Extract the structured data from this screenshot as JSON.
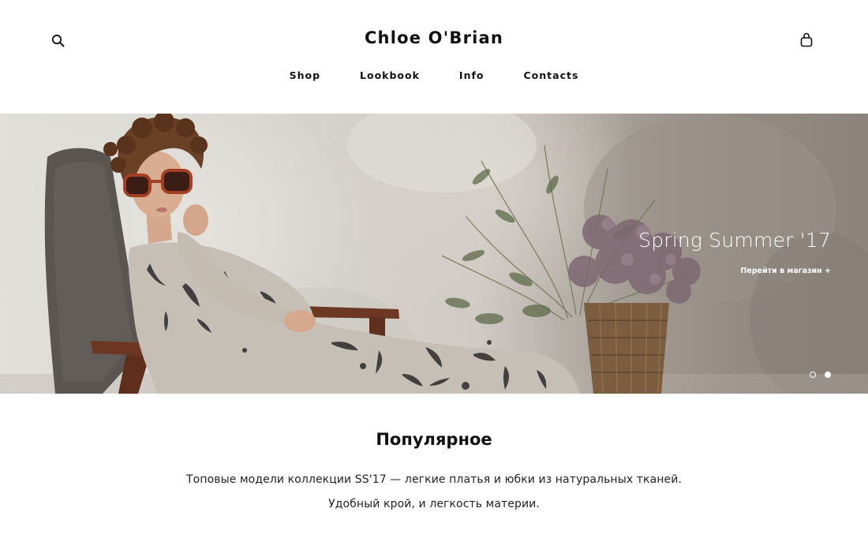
{
  "header": {
    "brand": "Chloe O'Brian",
    "search_icon": "search-icon",
    "cart_icon": "shopping-bag-icon",
    "nav": [
      {
        "label": "Shop"
      },
      {
        "label": "Lookbook"
      },
      {
        "label": "Info"
      },
      {
        "label": "Contacts"
      }
    ]
  },
  "hero": {
    "title": "Spring Summer  '17",
    "cta": "Перейти в магазин +",
    "slides_total": 2,
    "active_slide": 2
  },
  "popular": {
    "title": "Популярное",
    "line1": "Топовые модели коллекции SS'17 — легкие платья и юбки из натуральных тканей.",
    "line2": "Удобный крой, и легкость материи."
  },
  "colors": {
    "text": "#111111",
    "background": "#ffffff",
    "hero_text": "#ffffff"
  }
}
